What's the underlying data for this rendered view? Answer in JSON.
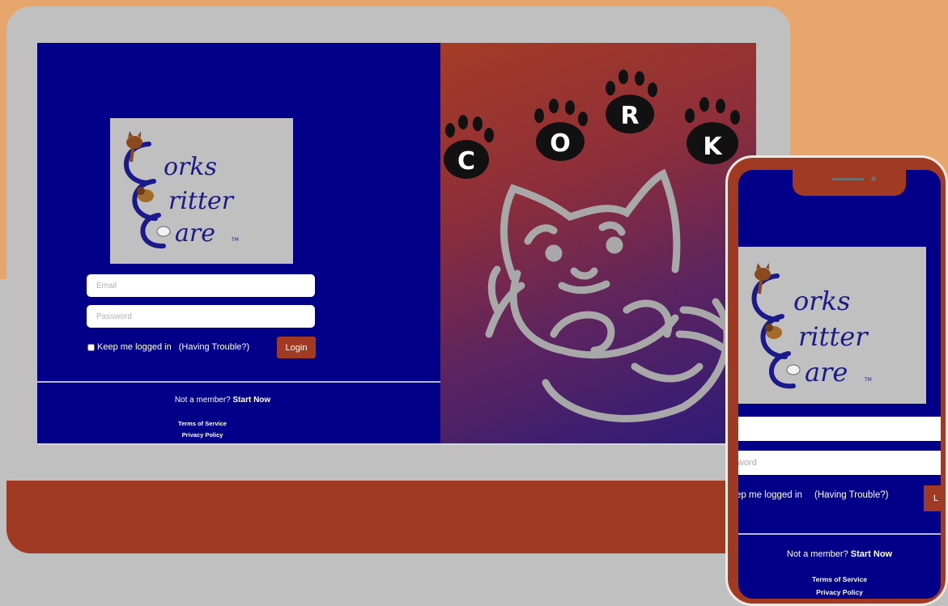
{
  "brand": {
    "logo_line1": "orks",
    "logo_line2": "ritter",
    "logo_line3": "are",
    "logo_tm": "TM",
    "paw_letters": [
      "C",
      "O",
      "R",
      "K"
    ]
  },
  "login": {
    "email_placeholder": "Email",
    "password_placeholder": "Password",
    "keep_logged_in": "Keep me logged in",
    "having_trouble": "(Having Trouble?)",
    "login_button": "Login"
  },
  "footer": {
    "not_member": "Not a member?",
    "start_now": "Start Now",
    "terms": "Terms of Service",
    "privacy": "Privacy Policy"
  },
  "phone": {
    "email_placeholder": "ail",
    "password_placeholder": "ssword",
    "keep_logged_in": "ep me logged in",
    "having_trouble": "(Having Trouble?)",
    "login_button": "L"
  },
  "colors": {
    "navy": "#020088",
    "rust": "#a13a22",
    "orange": "#e6a66c",
    "gray": "#c0c0c0"
  }
}
